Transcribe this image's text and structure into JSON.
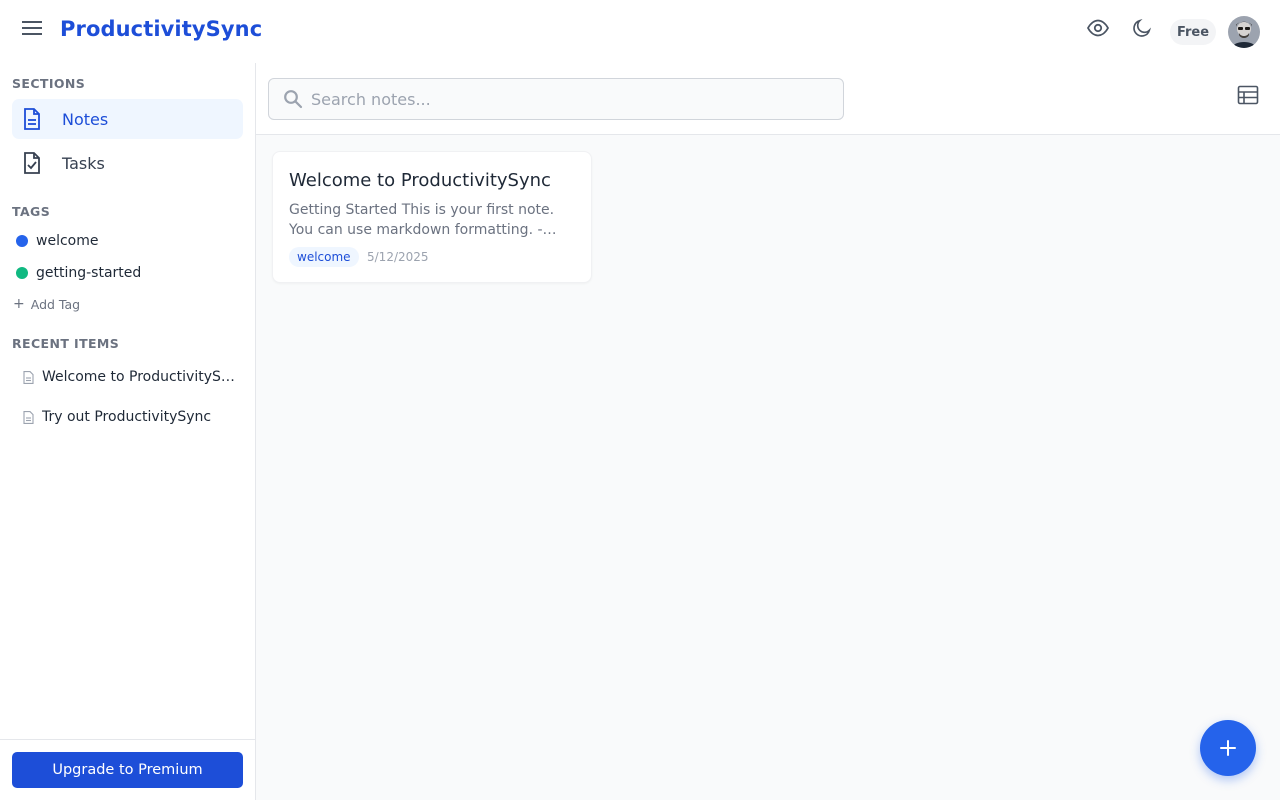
{
  "header": {
    "app_title": "ProductivitySync",
    "plan_badge": "Free",
    "icons": [
      "menu-icon",
      "eye-icon",
      "moon-icon"
    ]
  },
  "sidebar": {
    "sections_heading": "SECTIONS",
    "sections": [
      {
        "label": "Notes",
        "icon": "note-document-icon",
        "active": true
      },
      {
        "label": "Tasks",
        "icon": "task-checklist-icon",
        "active": false
      }
    ],
    "tags_heading": "TAGS",
    "tags": [
      {
        "label": "welcome",
        "color": "#2563eb"
      },
      {
        "label": "getting-started",
        "color": "#10b981"
      }
    ],
    "add_tag_label": "Add Tag",
    "recent_heading": "RECENT ITEMS",
    "recent_items": [
      {
        "label": "Welcome to ProductivitySync",
        "icon": "document-icon"
      },
      {
        "label": "Try out ProductivitySync",
        "icon": "document-icon"
      }
    ],
    "upgrade_label": "Upgrade to Premium"
  },
  "main": {
    "search_placeholder": "Search notes...",
    "search_value": "",
    "notes": [
      {
        "title": "Welcome to ProductivitySync",
        "excerpt": "Getting Started This is your first note. You can use markdown formatting. - Create notes",
        "tag": "welcome",
        "date": "5/12/2025"
      }
    ]
  },
  "colors": {
    "accent": "#1d4ed8",
    "fab": "#2563eb",
    "active_nav_bg": "#eff6ff"
  }
}
